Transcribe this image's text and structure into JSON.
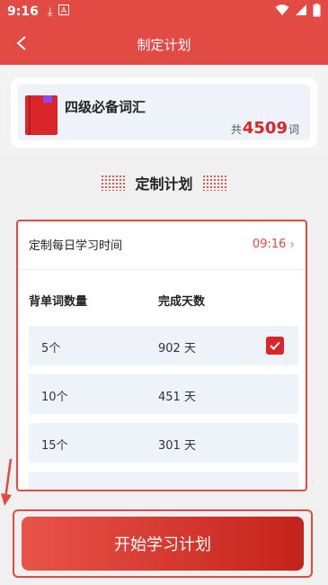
{
  "status_bar": {
    "time": "9:16",
    "icons": [
      "download-icon",
      "a-box-icon",
      "wifi-icon",
      "signal-icon",
      "battery-icon"
    ]
  },
  "nav": {
    "title": "制定计划",
    "back_icon": "chevron-left-icon"
  },
  "book": {
    "title": "四级必备词汇",
    "count_prefix": "共",
    "count": "4509",
    "count_suffix": "词"
  },
  "section": {
    "title": "定制计划"
  },
  "plan": {
    "time_label": "定制每日学习时间",
    "time_value": "09:16",
    "col_words": "背单词数量",
    "col_days": "完成天数",
    "options": [
      {
        "words": "5个",
        "days": "902 天",
        "selected": true
      },
      {
        "words": "10个",
        "days": "451 天",
        "selected": false
      },
      {
        "words": "15个",
        "days": "301 天",
        "selected": false
      }
    ]
  },
  "start_button": {
    "label": "开始学习计划"
  },
  "colors": {
    "primary": "#e24a44",
    "book_red": "#d9262a",
    "row_bg": "#eef2f9"
  }
}
